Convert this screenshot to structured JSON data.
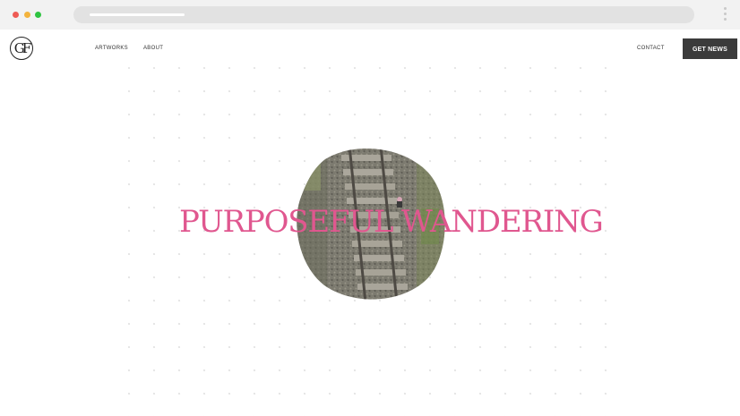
{
  "browser": {
    "window_controls": [
      "close",
      "minimize",
      "maximize"
    ],
    "menu_icon": "kebab-menu-icon"
  },
  "site": {
    "logo_text": "GF",
    "nav": {
      "artworks": "ARTWORKS",
      "about": "ABOUT",
      "contact": "CONTACT"
    },
    "cta_label": "GET NEWS"
  },
  "hero": {
    "title": "PURPOSEFUL WANDERING",
    "title_color": "#e0578f",
    "image_subject": "aerial view of railway tracks in a circular frame"
  }
}
